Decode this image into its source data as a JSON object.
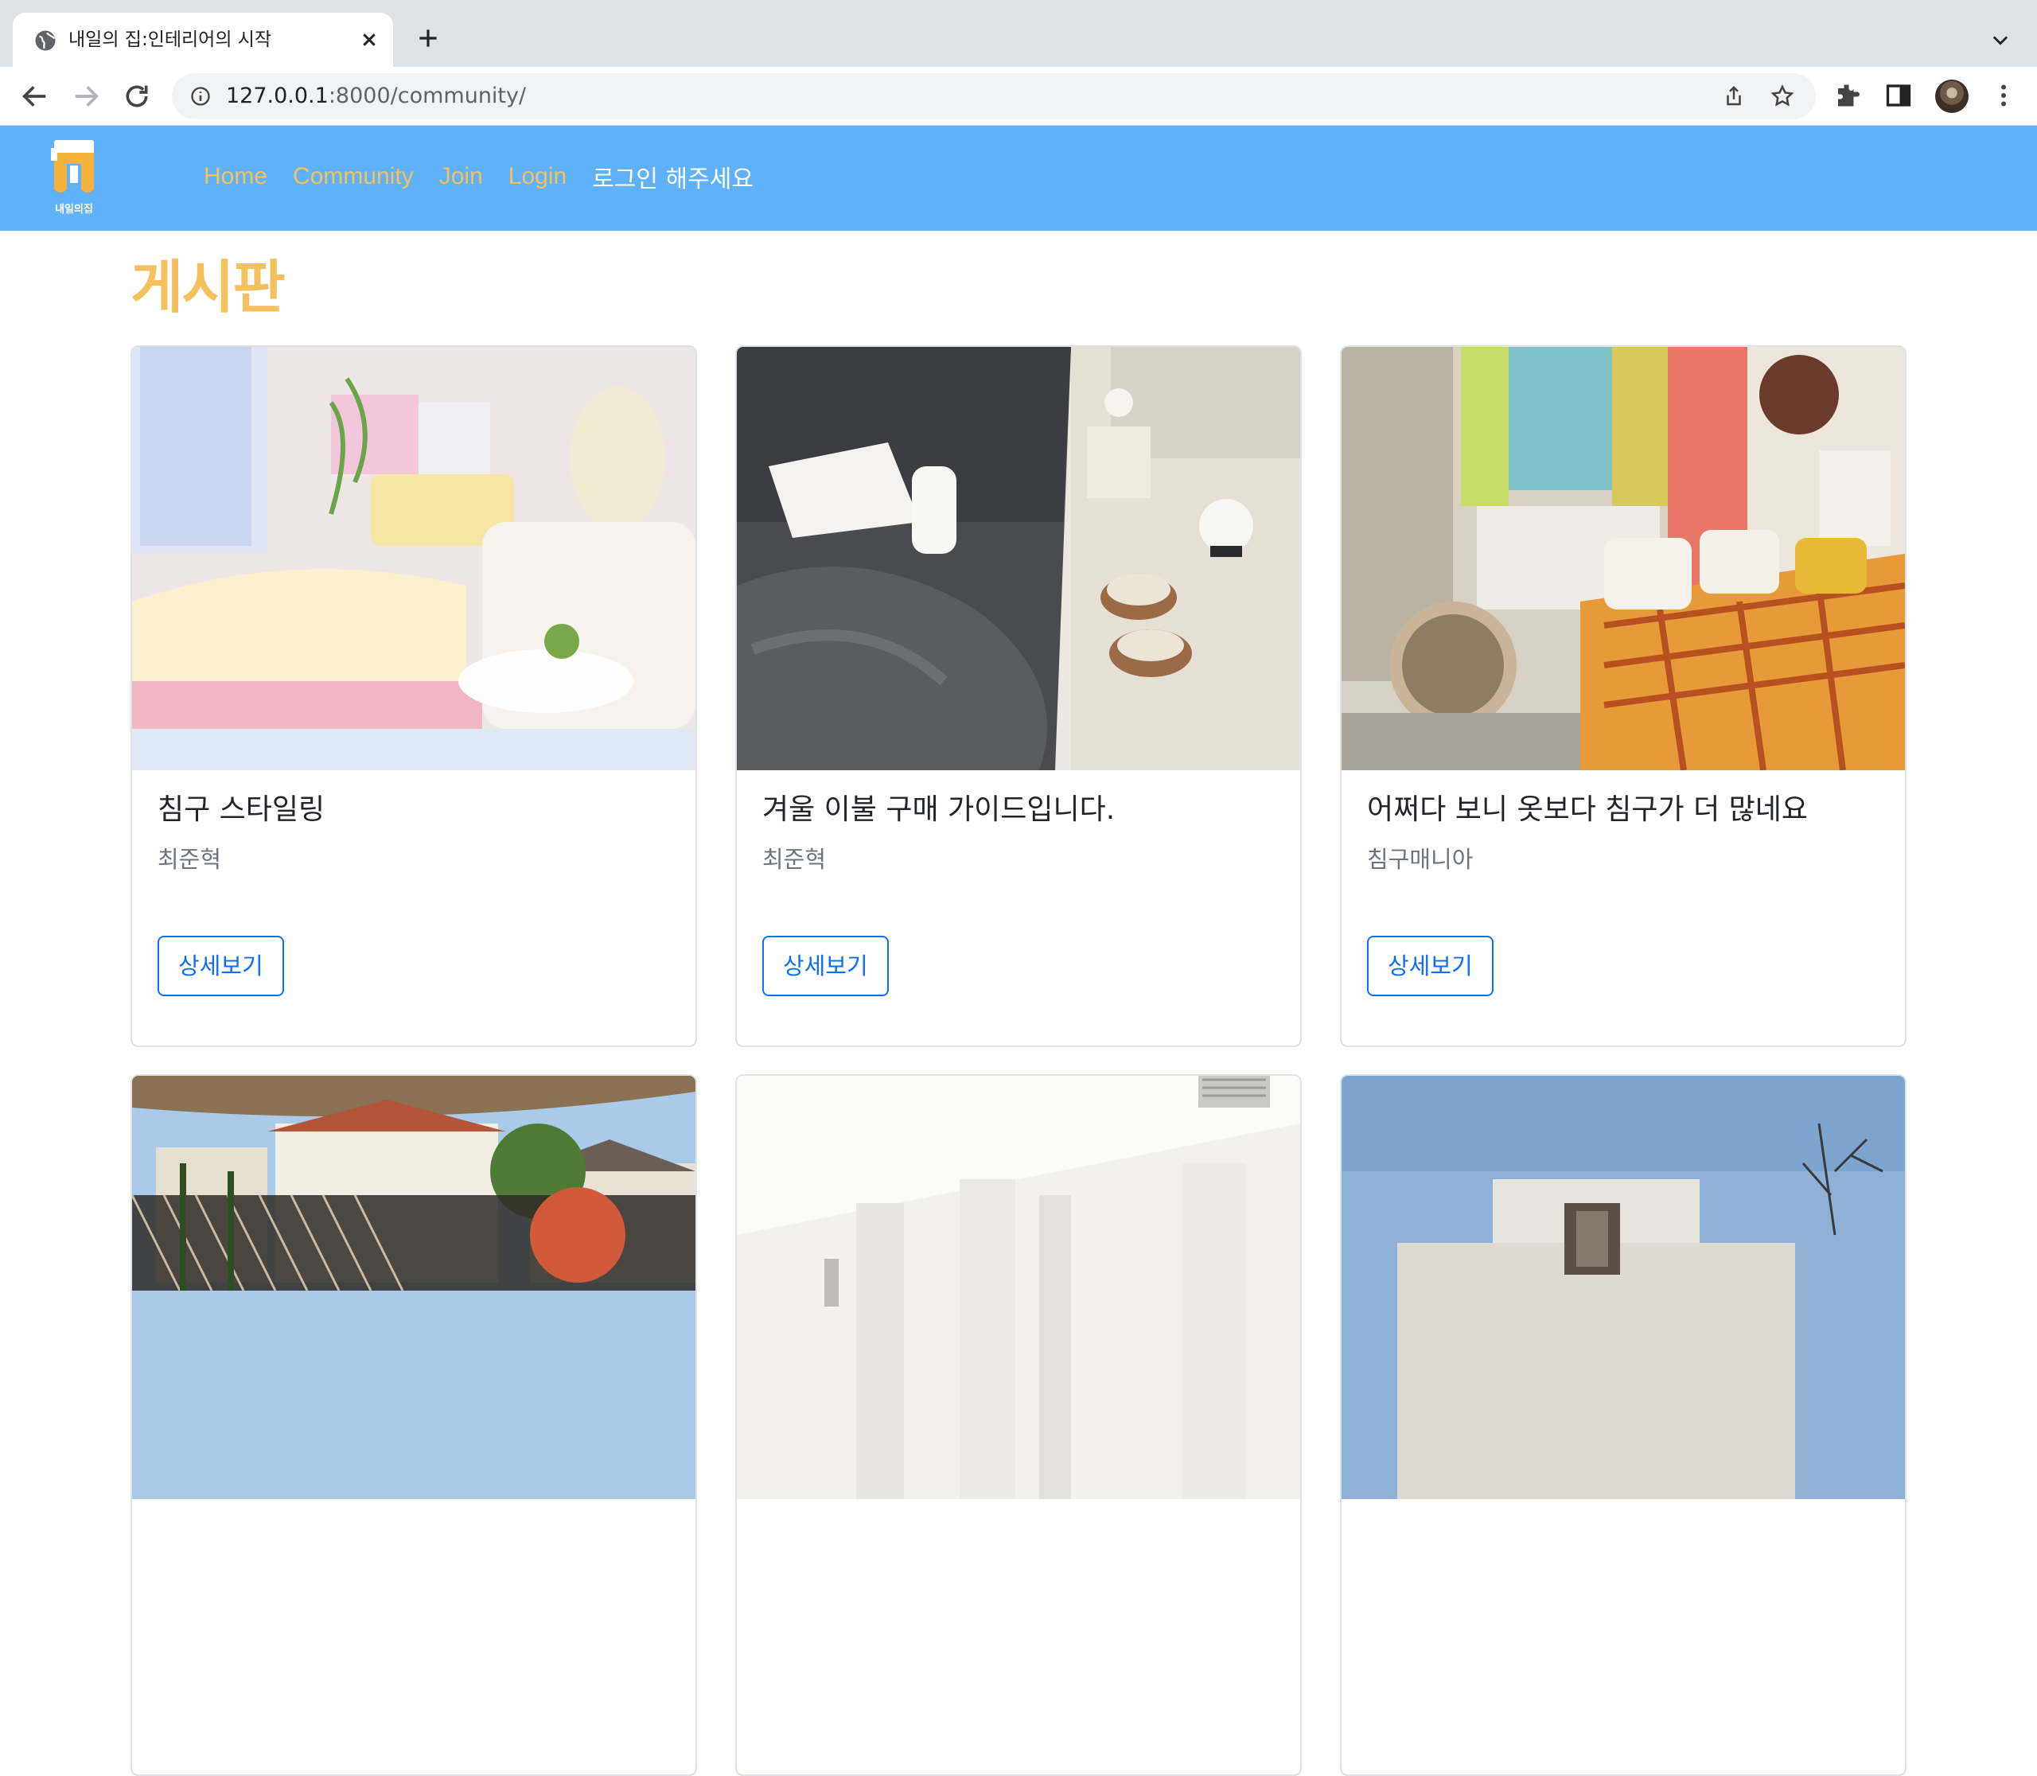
{
  "browser": {
    "tab_title": "내일의 집:인테리어의 시작",
    "url_host": "127.0.0.1",
    "url_rest": ":8000/community/"
  },
  "site": {
    "logo_text": "내일의집",
    "nav": {
      "home": "Home",
      "community": "Community",
      "join": "Join",
      "login": "Login",
      "greeting": "로그인 해주세요"
    },
    "page_title": "게시판",
    "colors": {
      "header_bg": "#5fb2fa",
      "accent": "#f5c15c",
      "button": "#0d6efd"
    }
  },
  "posts": [
    {
      "title": "침구 스타일링",
      "author": "최준혁",
      "button": "상세보기",
      "image": "pastel-bedroom"
    },
    {
      "title": "겨울 이불 구매 가이드입니다.",
      "author": "최준혁",
      "button": "상세보기",
      "image": "grey-bedding"
    },
    {
      "title": "어쩌다 보니 옷보다 침구가 더 많네요",
      "author": "침구매니아",
      "button": "상세보기",
      "image": "colorful-room"
    },
    {
      "title": "",
      "author": "",
      "button": "",
      "image": "garden-patio"
    },
    {
      "title": "",
      "author": "",
      "button": "",
      "image": "white-interior"
    },
    {
      "title": "",
      "author": "",
      "button": "",
      "image": "house-exterior"
    }
  ]
}
